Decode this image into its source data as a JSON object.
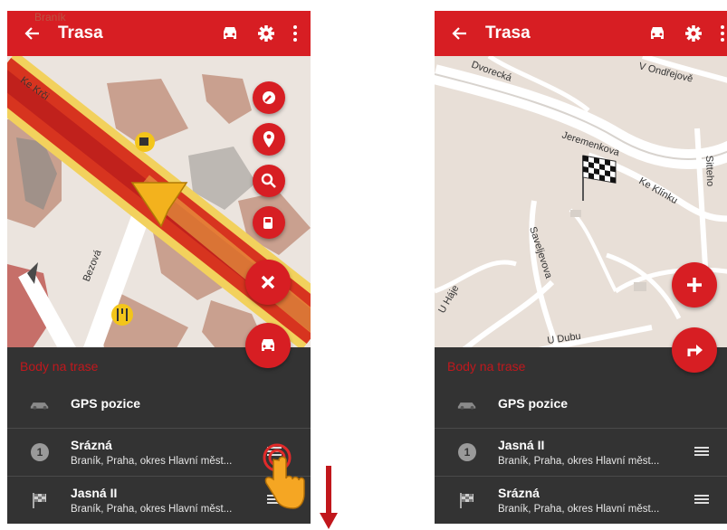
{
  "colors": {
    "accent": "#d71e23",
    "panel": "#333333",
    "header_text": "#c1181d"
  },
  "left_screen": {
    "title": "Trasa",
    "map_labels": {
      "top": "Braník",
      "street1": "Ke Krči",
      "street2": "Bezová"
    },
    "panel_header": "Body na trase",
    "rows": [
      {
        "icon": "car-icon",
        "title": "GPS pozice"
      },
      {
        "icon": "number-badge",
        "badge": "1",
        "title": "Srázná",
        "subtitle": "Braník, Praha, okres Hlavní měst..."
      },
      {
        "icon": "checkered-flag-icon",
        "title": "Jasná II",
        "subtitle": "Braník, Praha, okres Hlavní měst..."
      }
    ]
  },
  "right_screen": {
    "title": "Trasa",
    "map_labels": {
      "s1": "Dvorecká",
      "s2": "V Ondřejově",
      "s3": "Jeremenkova",
      "s4": "Ke Klínku",
      "s5": "Sitteho",
      "s6": "Saveljevova",
      "s7": "U Háje",
      "s8": "U Dubu"
    },
    "panel_header": "Body na trase",
    "rows": [
      {
        "icon": "car-icon",
        "title": "GPS pozice"
      },
      {
        "icon": "number-badge",
        "badge": "1",
        "title": "Jasná II",
        "subtitle": "Braník, Praha, okres Hlavní měst..."
      },
      {
        "icon": "checkered-flag-icon",
        "title": "Srázná",
        "subtitle": "Braník, Praha, okres Hlavní měst..."
      }
    ]
  }
}
